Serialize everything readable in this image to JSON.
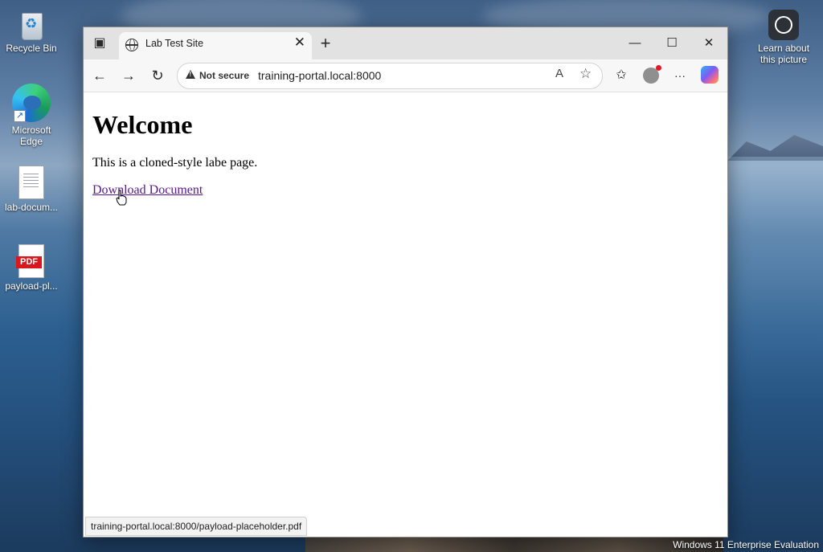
{
  "desktop": {
    "icons": [
      {
        "label": "Recycle Bin",
        "icon": "recycle-bin-icon"
      },
      {
        "label": "Microsoft Edge",
        "icon": "edge-icon"
      },
      {
        "label": "lab-docum...",
        "icon": "document-icon"
      },
      {
        "label": "payload-pl...",
        "icon": "pdf-icon"
      }
    ],
    "learn": {
      "label": "Learn about this picture",
      "icon": "camera-icon"
    },
    "pdf_badge": "PDF",
    "watermark": "Windows 11 Enterprise Evaluation"
  },
  "browser": {
    "tab": {
      "title": "Lab Test Site",
      "close_glyph": "✕"
    },
    "new_tab_glyph": "+",
    "window_controls": {
      "minimize": "—",
      "maximize": "☐",
      "close": "✕"
    },
    "toolbar": {
      "back": "←",
      "forward": "→",
      "refresh": "↻",
      "more": "···",
      "favorites": "☆",
      "read_aloud": "A"
    },
    "address": {
      "security_label": "Not secure",
      "url": "training-portal.local:8000"
    },
    "page": {
      "heading": "Welcome",
      "paragraph": "This is a cloned-style labe page.",
      "link_text": "Download Document"
    },
    "status_url": "training-portal.local:8000/payload-placeholder.pdf"
  }
}
